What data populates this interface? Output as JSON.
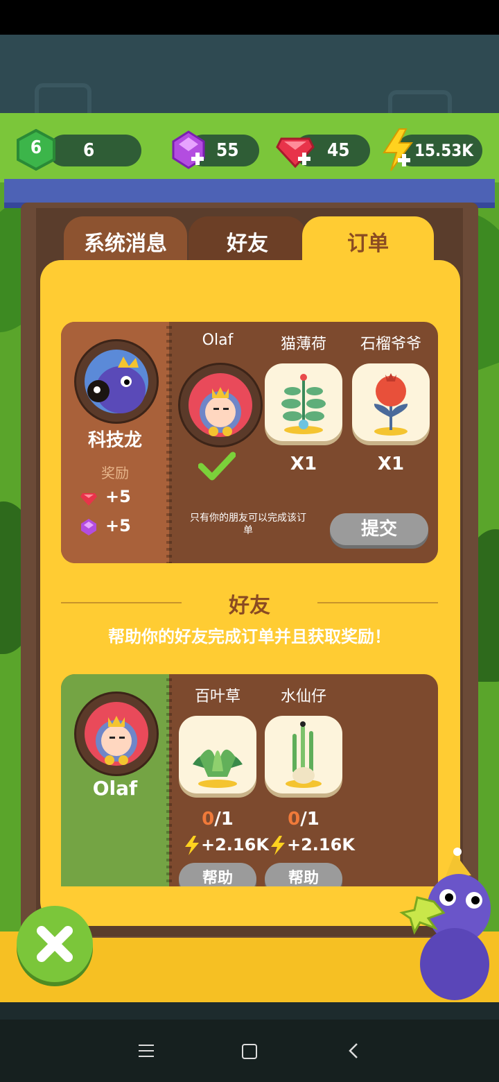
{
  "resources": {
    "level": "6",
    "level_value": "6",
    "purple_gems": "55",
    "red_gems": "45",
    "energy": "15.53K"
  },
  "tabs": [
    {
      "label": "系统消息"
    },
    {
      "label": "好友"
    },
    {
      "label": "订单"
    }
  ],
  "my_order": {
    "owner_name": "科技龙",
    "reward_label": "奖励",
    "rewards": [
      {
        "icon": "red-gem-icon",
        "amount": "+5"
      },
      {
        "icon": "purple-gem-icon",
        "amount": "+5"
      }
    ],
    "items": [
      {
        "name": "Olaf",
        "type": "friend-avatar",
        "status": "done"
      },
      {
        "name": "猫薄荷",
        "qty": "X1"
      },
      {
        "name": "石榴爷爷",
        "qty": "X1"
      }
    ],
    "note": "只有你的朋友可以完成该订单",
    "submit_label": "提交"
  },
  "friends_section": {
    "title": "好友",
    "subtitle": "帮助你的好友完成订单并且获取奖励！"
  },
  "friend_order": {
    "owner_name": "Olaf",
    "items": [
      {
        "name": "百叶草",
        "progress_done": "0",
        "progress_total": "/1",
        "reward": "+2.16K",
        "help_label": "帮助"
      },
      {
        "name": "水仙仔",
        "progress_done": "0",
        "progress_total": "/1",
        "reward": "+2.16K",
        "help_label": "帮助"
      }
    ]
  },
  "colors": {
    "panel": "#ffcc33",
    "card": "#7d4a2e",
    "accent_green": "#7bc63a",
    "close_button": "#7bc63a"
  }
}
